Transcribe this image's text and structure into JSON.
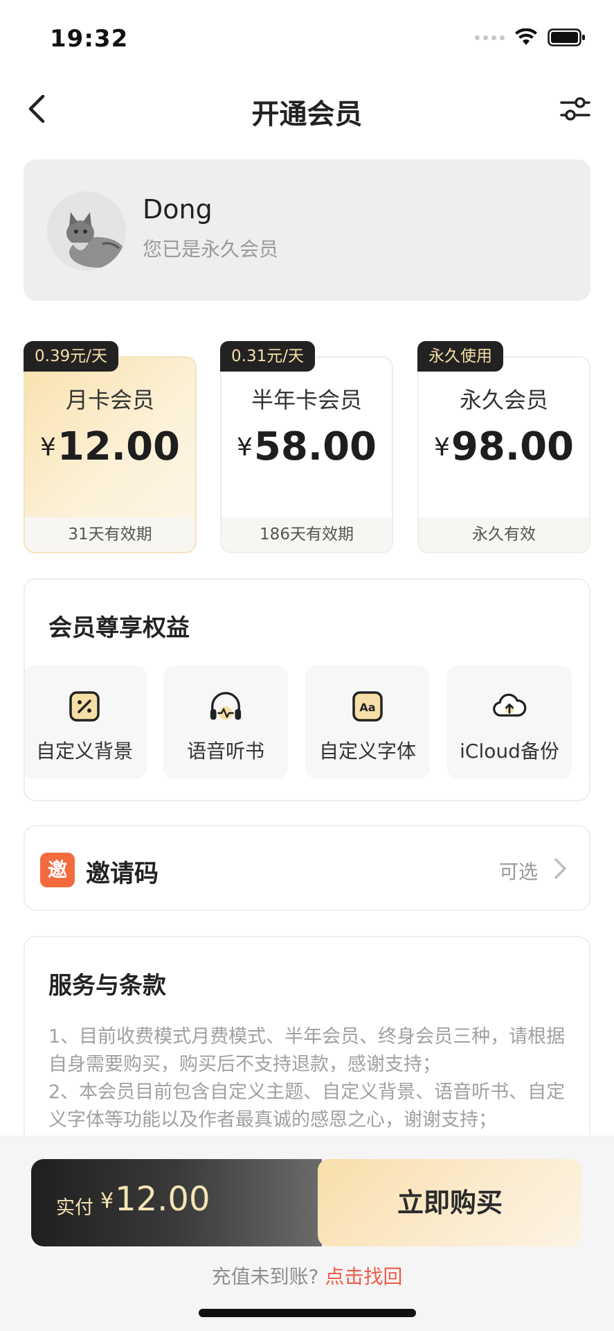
{
  "status_bar": {
    "time": "19:32"
  },
  "nav": {
    "title": "开通会员",
    "back_icon": "chevron-left-icon",
    "settings_icon": "sliders-icon"
  },
  "profile": {
    "name": "Dong",
    "status": "您已是永久会员"
  },
  "plans": [
    {
      "tag": "0.39元/天",
      "name": "月卡会员",
      "currency": "¥",
      "price": "12.00",
      "validity": "31天有效期",
      "selected": true
    },
    {
      "tag": "0.31元/天",
      "name": "半年卡会员",
      "currency": "¥",
      "price": "58.00",
      "validity": "186天有效期",
      "selected": false
    },
    {
      "tag": "永久使用",
      "name": "永久会员",
      "currency": "¥",
      "price": "98.00",
      "validity": "永久有效",
      "selected": false
    }
  ],
  "benefits": {
    "title": "会员尊享权益",
    "items": [
      {
        "label": "自定义背景",
        "icon": "custom-background-icon"
      },
      {
        "label": "语音听书",
        "icon": "headphones-icon"
      },
      {
        "label": "自定义字体",
        "icon": "font-icon"
      },
      {
        "label": "iCloud备份",
        "icon": "cloud-upload-icon"
      }
    ]
  },
  "invite": {
    "badge": "邀",
    "label": "邀请码",
    "optional": "可选"
  },
  "terms": {
    "title": "服务与条款",
    "line1": "1、目前收费模式月费模式、半年会员、终身会员三种，请根据自身需要购买，购买后不支持退款，感谢支持；",
    "line2": "2、本会员目前包含自定义主题、自定义背景、语音听书、自定义字体等功能以及作者最真诚的感恩之心，谢谢支持；"
  },
  "payment": {
    "label": "实付",
    "currency": "¥",
    "amount": "12.00",
    "buy_label": "立即购买",
    "recovery_text": "充值未到账?",
    "recovery_link": "点击找回"
  },
  "colors": {
    "accent_gold": "#f6e4b6",
    "link_red": "#ef5a4a",
    "badge_orange": "#f36a3e",
    "tag_dark": "#222222"
  }
}
